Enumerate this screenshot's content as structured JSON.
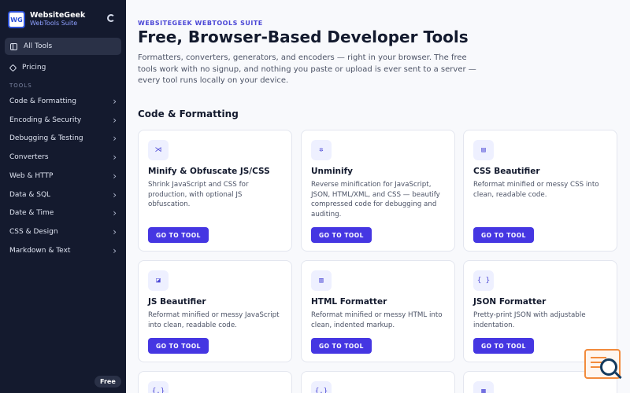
{
  "brand": {
    "name": "WebsiteGeek",
    "sub": "WebTools Suite",
    "logo_text": "WG"
  },
  "sidebar": {
    "all_tools": "All Tools",
    "pricing": "Pricing",
    "section_label": "TOOLS",
    "categories": [
      "Code & Formatting",
      "Encoding & Security",
      "Debugging & Testing",
      "Converters",
      "Web & HTTP",
      "Data & SQL",
      "Date & Time",
      "CSS & Design",
      "Markdown & Text"
    ],
    "badge": "Free"
  },
  "main": {
    "eyebrow": "WEBSITEGEEK WEBTOOLS SUITE",
    "title": "Free, Browser-Based Developer Tools",
    "intro": "Formatters, converters, generators, and encoders — right in your browser. The free tools work with no signup, and nothing you paste or upload is ever sent to a server — every tool runs locally on your device.",
    "section_title": "Code & Formatting",
    "cards": [
      {
        "icon": "⋊",
        "title": "Minify & Obfuscate JS/CSS",
        "desc": "Shrink JavaScript and CSS for production, with optional JS obfuscation.",
        "button": "GO TO TOOL"
      },
      {
        "icon": "✲",
        "title": "Unminify",
        "desc": "Reverse minification for JavaScript, JSON, HTML/XML, and CSS — beautify compressed code for debugging and auditing.",
        "button": "GO TO TOOL"
      },
      {
        "icon": "▤",
        "title": "CSS Beautifier",
        "desc": "Reformat minified or messy CSS into clean, readable code.",
        "button": "GO TO TOOL"
      },
      {
        "icon": "◪",
        "title": "JS Beautifier",
        "desc": "Reformat minified or messy JavaScript into clean, readable code.",
        "button": "GO TO TOOL"
      },
      {
        "icon": "▥",
        "title": "HTML Formatter",
        "desc": "Reformat minified or messy HTML into clean, indented markup.",
        "button": "GO TO TOOL"
      },
      {
        "icon": "{ }",
        "title": "JSON Formatter",
        "desc": "Pretty-print JSON with adjustable indentation.",
        "button": "GO TO TOOL"
      },
      {
        "icon": "{.}"
      },
      {
        "icon": "{.}"
      },
      {
        "icon": "▦"
      }
    ]
  },
  "colors": {
    "accent": "#4536e2",
    "sidebar_bg": "#141a2e",
    "eyebrow": "#4b47d6"
  }
}
